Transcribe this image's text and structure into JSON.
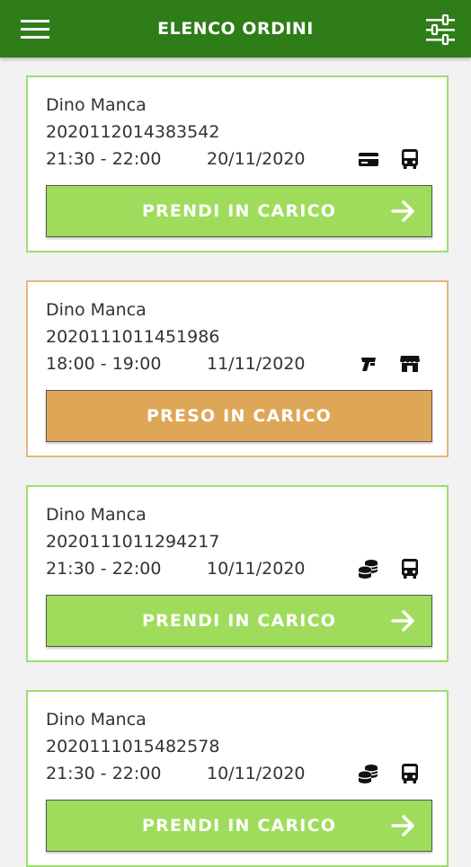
{
  "header": {
    "title": "ELENCO ORDINI",
    "menu_icon": "hamburger-menu-icon",
    "filter_icon": "sliders-filter-icon",
    "background_color": "#2e7d18"
  },
  "colors": {
    "pending_border": "#9be06b",
    "pending_button": "#9fdc5c",
    "taken_border": "#e8b47a",
    "taken_button": "#dea758"
  },
  "orders": [
    {
      "customer": "Dino Manca",
      "code": "2020112014383542",
      "time_slot": "21:30 - 22:00",
      "date": "20/11/2020",
      "payment_icon": "credit-card-icon",
      "delivery_icon": "bus-delivery-icon",
      "status": "pending",
      "button_label": "PRENDI IN CARICO",
      "button_icon": "arrow-right-icon"
    },
    {
      "customer": "Dino Manca",
      "code": "2020111011451986",
      "time_slot": "18:00 - 19:00",
      "date": "11/11/2020",
      "payment_icon": "pos-terminal-icon",
      "delivery_icon": "store-pickup-icon",
      "status": "taken",
      "button_label": "PRESO IN CARICO"
    },
    {
      "customer": "Dino Manca",
      "code": "2020111011294217",
      "time_slot": "21:30 - 22:00",
      "date": "10/11/2020",
      "payment_icon": "coins-icon",
      "delivery_icon": "bus-delivery-icon",
      "status": "pending",
      "button_label": "PRENDI IN CARICO",
      "button_icon": "arrow-right-icon"
    },
    {
      "customer": "Dino Manca",
      "code": "2020111015482578",
      "time_slot": "21:30 - 22:00",
      "date": "10/11/2020",
      "payment_icon": "coins-icon",
      "delivery_icon": "bus-delivery-icon",
      "status": "pending",
      "button_label": "PRENDI IN CARICO",
      "button_icon": "arrow-right-icon"
    }
  ]
}
